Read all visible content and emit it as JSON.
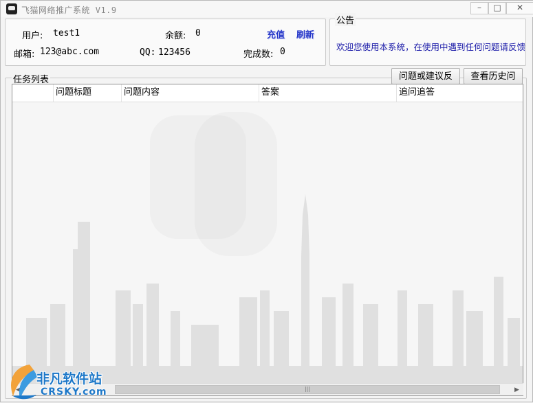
{
  "window": {
    "title": "飞猫网络推广系统 V1.9"
  },
  "account": {
    "user_label": "用户:",
    "user_value": "test1",
    "balance_label": "余额:",
    "balance_value": "0",
    "recharge_label": "充值",
    "refresh_label": "刷新",
    "email_label": "邮箱:",
    "email_value": "123@abc.com",
    "qq_label": "QQ:",
    "qq_value": "123456",
    "completed_label": "完成数:",
    "completed_value": "0"
  },
  "notice": {
    "legend": "公告",
    "text": "欢迎您使用本系统，在使用中遇到任何问题请反馈"
  },
  "tasks": {
    "legend": "任务列表",
    "feedback_button": "问题或建议反馈",
    "history_button": "查看历史问答",
    "columns": [
      "",
      "问题标题",
      "问题内容",
      "答案",
      "追问追答"
    ],
    "rows": []
  },
  "watermark": {
    "name": "非凡软件站",
    "site": "CRSKY.com"
  },
  "colors": {
    "link": "#2436c8",
    "notice_text": "#1a1aa8",
    "watermark": "#1e78c8"
  }
}
